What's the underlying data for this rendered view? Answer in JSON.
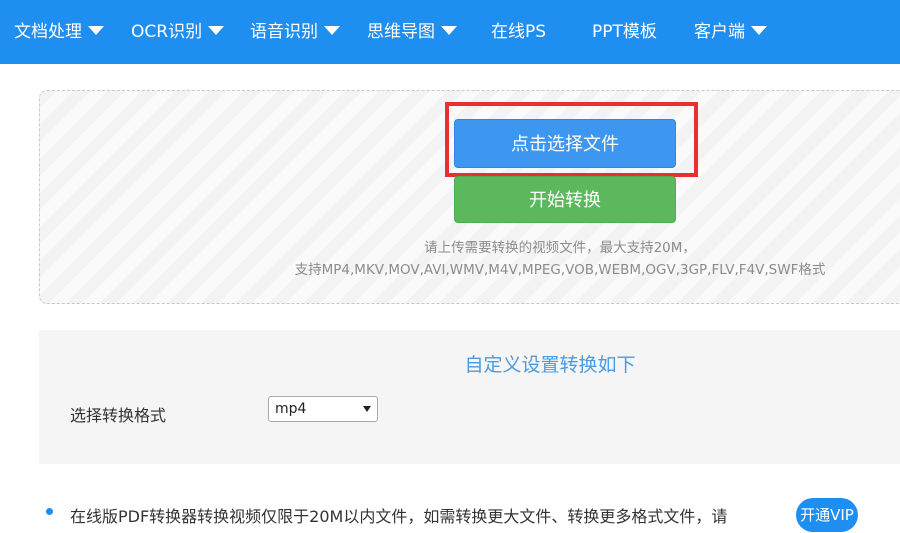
{
  "nav": {
    "items": [
      {
        "label": "文档处理",
        "dropdown": true
      },
      {
        "label": "OCR识别",
        "dropdown": true
      },
      {
        "label": "语音识别",
        "dropdown": true
      },
      {
        "label": "思维导图",
        "dropdown": true
      },
      {
        "label": "在线PS",
        "dropdown": false
      },
      {
        "label": "PPT模板",
        "dropdown": false
      },
      {
        "label": "客户端",
        "dropdown": true
      }
    ]
  },
  "upload": {
    "select_label": "点击选择文件",
    "convert_label": "开始转换",
    "tip_line1": "请上传需要转换的视频文件，最大支持20M，",
    "tip_line2": "支持MP4,MKV,MOV,AVI,WMV,M4V,MPEG,VOB,WEBM,OGV,3GP,FLV,F4V,SWF格式"
  },
  "settings": {
    "title": "自定义设置转换如下",
    "format_label": "选择转换格式",
    "format_value": "mp4"
  },
  "notice": {
    "text": "在线版PDF转换器转换视频仅限于20M以内文件，如需转换更大文件、转换更多格式文件，请",
    "vip_label": "开通VIP"
  },
  "colors": {
    "nav_bg": "#1f8ef1",
    "select_button": "#3d97f0",
    "convert_button": "#5cb85c",
    "highlight": "#e8302f",
    "title_blue": "#4a9be0"
  }
}
